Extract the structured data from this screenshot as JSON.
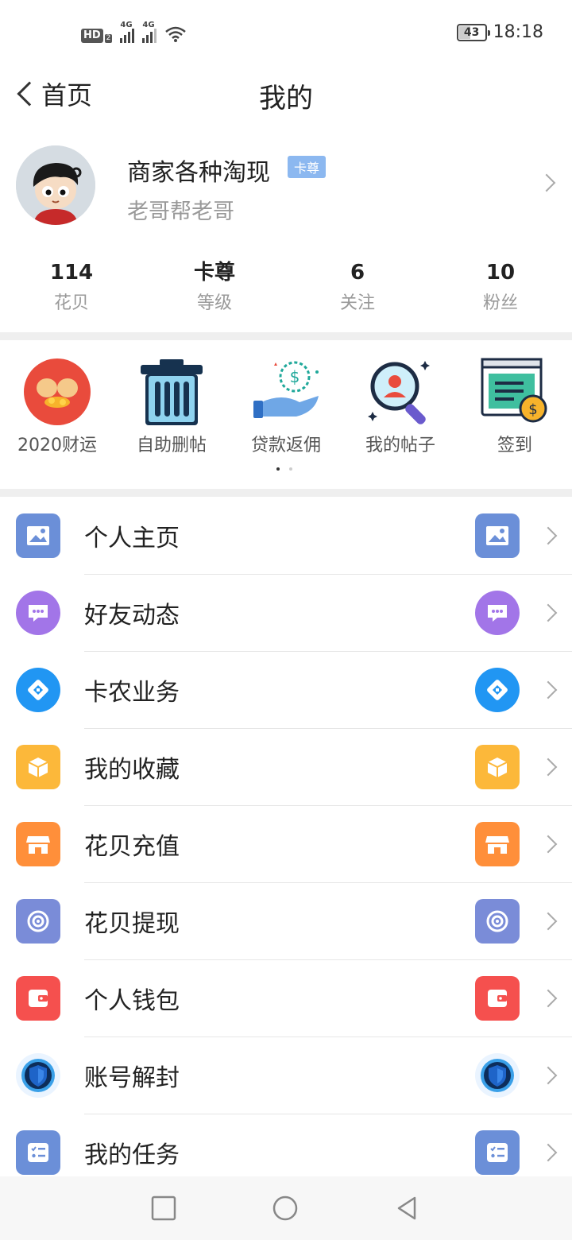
{
  "status_bar": {
    "hd": "HD",
    "hd_sub": "2",
    "net1": "4G",
    "net2": "4G",
    "battery": "43",
    "time": "18:18"
  },
  "nav": {
    "back_label": "首页",
    "title": "我的"
  },
  "profile": {
    "name": "商家各种淘现",
    "rank_badge": "卡尊",
    "subtitle": "老哥帮老哥"
  },
  "stats": [
    {
      "value": "114",
      "label": "花贝"
    },
    {
      "value": "卡尊",
      "label": "等级"
    },
    {
      "value": "6",
      "label": "关注"
    },
    {
      "value": "10",
      "label": "粉丝"
    }
  ],
  "quick_actions": [
    {
      "label": "2020财运",
      "icon": "fortune-icon"
    },
    {
      "label": "自助删帖",
      "icon": "trash-icon"
    },
    {
      "label": "贷款返佣",
      "icon": "loan-rebate-icon"
    },
    {
      "label": "我的帖子",
      "icon": "my-posts-icon"
    },
    {
      "label": "签到",
      "icon": "check-in-icon"
    }
  ],
  "menu": [
    {
      "label": "个人主页",
      "icon": "image-icon",
      "color": "#6b8fd8"
    },
    {
      "label": "好友动态",
      "icon": "chat-bubble-icon",
      "color": "#a275e8"
    },
    {
      "label": "卡农业务",
      "icon": "handshake-icon",
      "color": "#2196f3"
    },
    {
      "label": "我的收藏",
      "icon": "box-icon",
      "color": "#fcb83a"
    },
    {
      "label": "花贝充值",
      "icon": "shop-icon",
      "color": "#ff8f3a"
    },
    {
      "label": "花贝提现",
      "icon": "disc-icon",
      "color": "#7a8cd8"
    },
    {
      "label": "个人钱包",
      "icon": "wallet-icon",
      "color": "#f5504e"
    },
    {
      "label": "账号解封",
      "icon": "shield-icon",
      "color": "#1e64c8"
    },
    {
      "label": "我的任务",
      "icon": "task-list-icon",
      "color": "#6b8fd8"
    }
  ]
}
